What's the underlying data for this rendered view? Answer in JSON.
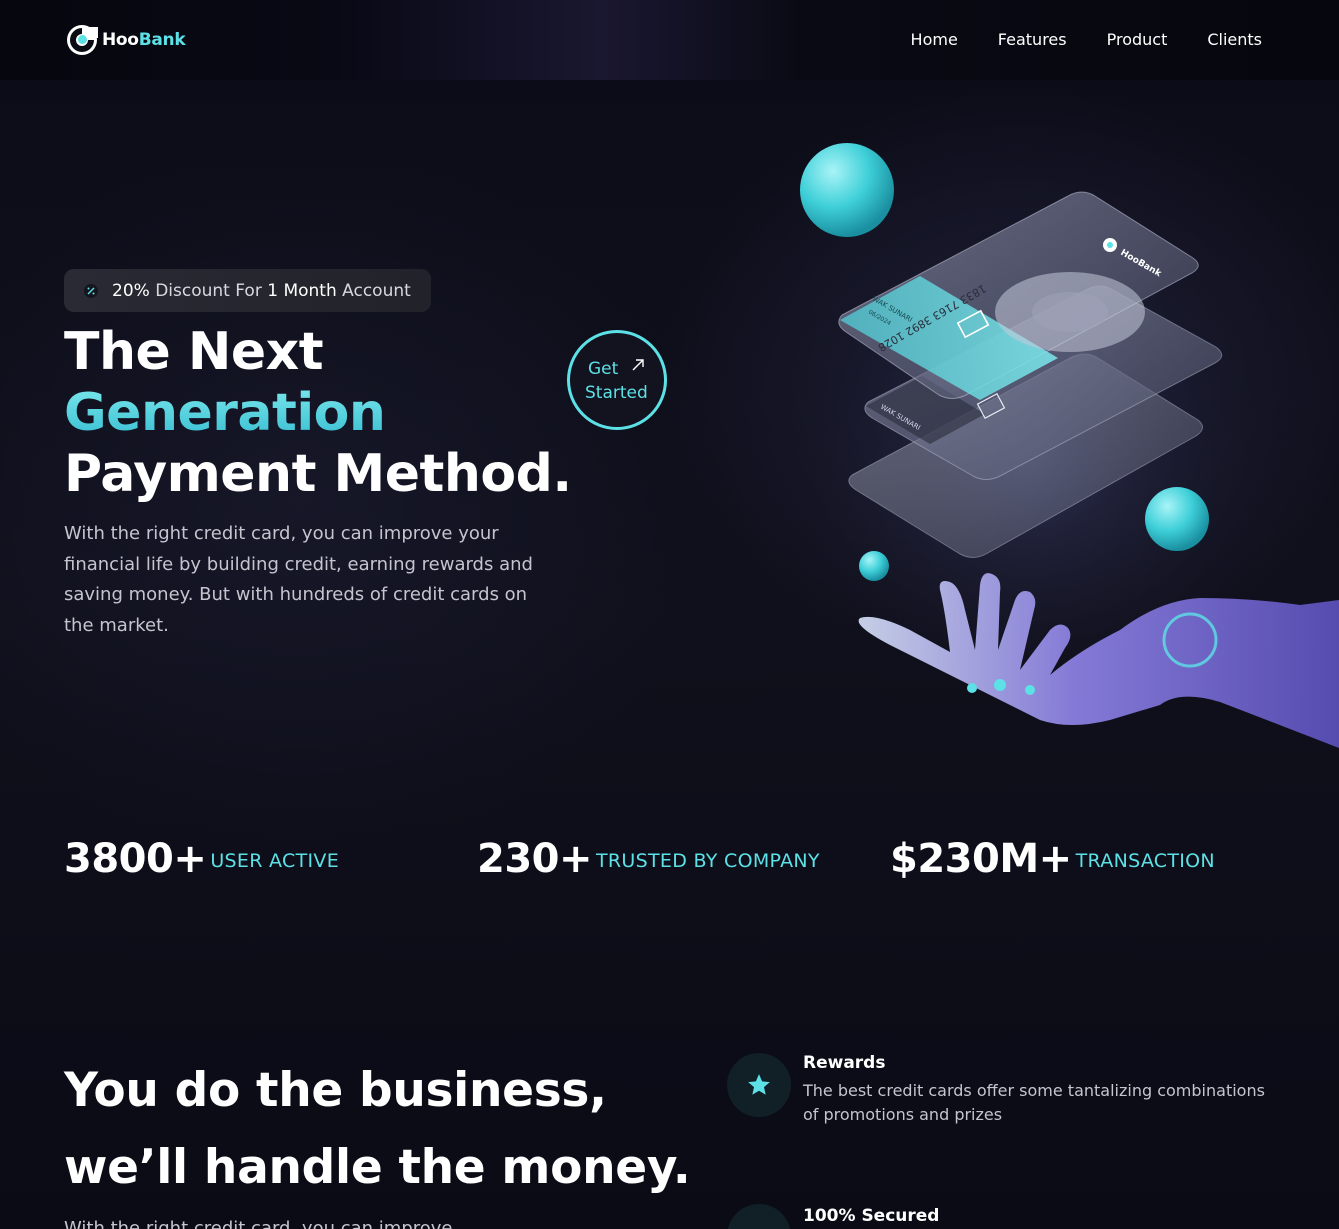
{
  "brand": {
    "name_part1": "Hoo",
    "name_part2": "Bank",
    "accent": "#5ce1e6",
    "background": "#0b0b15"
  },
  "nav": {
    "links": [
      "Home",
      "Features",
      "Product",
      "Clients"
    ]
  },
  "hero": {
    "badge": {
      "percent": "20%",
      "text_a": "Discount For",
      "number": "1",
      "text_b": "Month",
      "text_c": "Account",
      "icon": "percent-icon"
    },
    "title_line1": "The Next",
    "title_line2": "Generation",
    "title_line3": "Payment Method.",
    "description": "With the right credit card, you can improve your financial life by building credit, earning rewards and saving money. But with hundreds of credit cards on the market.",
    "cta_line1": "Get",
    "cta_line2": "Started",
    "cta_icon": "arrow-up-right-icon",
    "card": {
      "number": "1833 7163 3892 1028",
      "holder": "WAK SUNARI",
      "expiry": "06/2024",
      "brand": "HooBank"
    }
  },
  "stats": [
    {
      "value": "3800+",
      "label": "USER ACTIVE"
    },
    {
      "value": "230+",
      "label": "TRUSTED BY COMPANY"
    },
    {
      "value": "$230M+",
      "label": "TRANSACTION"
    }
  ],
  "business": {
    "title_line1": "You do the business,",
    "title_line2": "we’ll handle the money.",
    "description_partial": "With the right credit card, you can improve",
    "features": [
      {
        "title": "Rewards",
        "description": "The best credit cards offer some tantalizing combinations of promotions and prizes",
        "icon": "star-icon"
      },
      {
        "title": "100% Secured",
        "description": "",
        "icon": "shield-icon"
      }
    ]
  }
}
